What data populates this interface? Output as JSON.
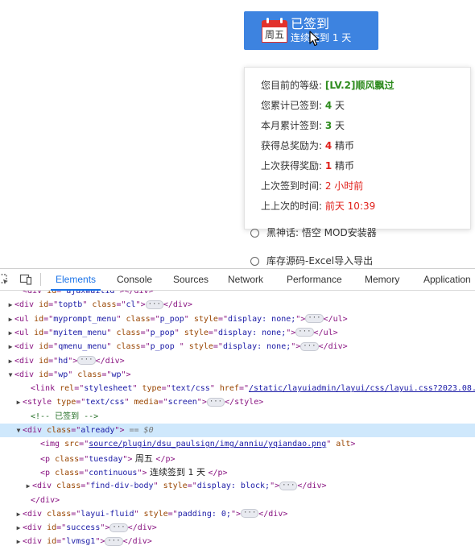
{
  "sign": {
    "weekday": "周五",
    "title": "已签到",
    "subtitle": "连续签到 1 天"
  },
  "popup": {
    "rows": [
      {
        "label": "您目前的等级:",
        "value": "[LV.2]顺风飘过",
        "unit": "",
        "color": "#2e8b1e"
      },
      {
        "label": "您累计已签到:",
        "value": "4",
        "unit": " 天",
        "color": "#2e8b1e"
      },
      {
        "label": "本月累计签到:",
        "value": "3",
        "unit": " 天",
        "color": "#2e8b1e"
      },
      {
        "label": "获得总奖励为:",
        "value": "4",
        "unit": " 精币",
        "color": "#e0201a"
      },
      {
        "label": "上次获得奖励:",
        "value": "1",
        "unit": " 精币",
        "color": "#e0201a"
      },
      {
        "label": "上次签到时间:",
        "value": "2 小时前",
        "unit": "",
        "color": "#e0201a"
      },
      {
        "label": "上上次的时间:",
        "value": "前天 10:39",
        "unit": "",
        "color": "#e0201a"
      }
    ]
  },
  "options": [
    {
      "label": "黑神话: 悟空 MOD安装器"
    },
    {
      "label": "库存源码-Excel导入导出"
    }
  ],
  "devtools": {
    "tabs": [
      "Elements",
      "Console",
      "Sources",
      "Network",
      "Performance",
      "Memory",
      "Application"
    ],
    "active_tab": "Elements",
    "lines": [
      {
        "indent": 28,
        "arrow": "",
        "parts": [
          {
            "c": "t",
            "v": "<div "
          },
          {
            "c": "an",
            "v": "id"
          },
          {
            "c": "t",
            "v": "=\""
          },
          {
            "c": "av",
            "v": "ajaxwaitid"
          },
          {
            "c": "t",
            "v": "\"></div>"
          }
        ]
      },
      {
        "indent": 18,
        "arrow": "▶",
        "parts": [
          {
            "c": "t",
            "v": "<div "
          },
          {
            "c": "an",
            "v": "id"
          },
          {
            "c": "t",
            "v": "=\""
          },
          {
            "c": "av",
            "v": "toptb"
          },
          {
            "c": "t",
            "v": "\" "
          },
          {
            "c": "an",
            "v": "class"
          },
          {
            "c": "t",
            "v": "=\""
          },
          {
            "c": "av",
            "v": "cl"
          },
          {
            "c": "t",
            "v": "\">"
          },
          {
            "c": "ell",
            "v": "···"
          },
          {
            "c": "t",
            "v": "</div>"
          }
        ]
      },
      {
        "indent": 18,
        "arrow": "▶",
        "parts": [
          {
            "c": "t",
            "v": "<ul "
          },
          {
            "c": "an",
            "v": "id"
          },
          {
            "c": "t",
            "v": "=\""
          },
          {
            "c": "av",
            "v": "myprompt_menu"
          },
          {
            "c": "t",
            "v": "\" "
          },
          {
            "c": "an",
            "v": "class"
          },
          {
            "c": "t",
            "v": "=\""
          },
          {
            "c": "av",
            "v": "p_pop"
          },
          {
            "c": "t",
            "v": "\" "
          },
          {
            "c": "an",
            "v": "style"
          },
          {
            "c": "t",
            "v": "=\""
          },
          {
            "c": "av",
            "v": "display: none;"
          },
          {
            "c": "t",
            "v": "\">"
          },
          {
            "c": "ell",
            "v": "···"
          },
          {
            "c": "t",
            "v": "</ul>"
          }
        ]
      },
      {
        "indent": 18,
        "arrow": "▶",
        "parts": [
          {
            "c": "t",
            "v": "<ul "
          },
          {
            "c": "an",
            "v": "id"
          },
          {
            "c": "t",
            "v": "=\""
          },
          {
            "c": "av",
            "v": "myitem_menu"
          },
          {
            "c": "t",
            "v": "\" "
          },
          {
            "c": "an",
            "v": "class"
          },
          {
            "c": "t",
            "v": "=\""
          },
          {
            "c": "av",
            "v": "p_pop"
          },
          {
            "c": "t",
            "v": "\" "
          },
          {
            "c": "an",
            "v": "style"
          },
          {
            "c": "t",
            "v": "=\""
          },
          {
            "c": "av",
            "v": "display: none;"
          },
          {
            "c": "t",
            "v": "\">"
          },
          {
            "c": "ell",
            "v": "···"
          },
          {
            "c": "t",
            "v": "</ul>"
          }
        ]
      },
      {
        "indent": 18,
        "arrow": "▶",
        "parts": [
          {
            "c": "t",
            "v": "<div "
          },
          {
            "c": "an",
            "v": "id"
          },
          {
            "c": "t",
            "v": "=\""
          },
          {
            "c": "av",
            "v": "qmenu_menu"
          },
          {
            "c": "t",
            "v": "\" "
          },
          {
            "c": "an",
            "v": "class"
          },
          {
            "c": "t",
            "v": "=\""
          },
          {
            "c": "av",
            "v": "p_pop "
          },
          {
            "c": "t",
            "v": "\" "
          },
          {
            "c": "an",
            "v": "style"
          },
          {
            "c": "t",
            "v": "=\""
          },
          {
            "c": "av",
            "v": "display: none;"
          },
          {
            "c": "t",
            "v": "\">"
          },
          {
            "c": "ell",
            "v": "···"
          },
          {
            "c": "t",
            "v": "</div>"
          }
        ]
      },
      {
        "indent": 18,
        "arrow": "▶",
        "parts": [
          {
            "c": "t",
            "v": "<div "
          },
          {
            "c": "an",
            "v": "id"
          },
          {
            "c": "t",
            "v": "=\""
          },
          {
            "c": "av",
            "v": "hd"
          },
          {
            "c": "t",
            "v": "\">"
          },
          {
            "c": "ell",
            "v": "···"
          },
          {
            "c": "t",
            "v": "</div>"
          }
        ]
      },
      {
        "indent": 18,
        "arrow": "▼",
        "parts": [
          {
            "c": "t",
            "v": "<div "
          },
          {
            "c": "an",
            "v": "id"
          },
          {
            "c": "t",
            "v": "=\""
          },
          {
            "c": "av",
            "v": "wp"
          },
          {
            "c": "t",
            "v": "\" "
          },
          {
            "c": "an",
            "v": "class"
          },
          {
            "c": "t",
            "v": "=\""
          },
          {
            "c": "av",
            "v": "wp"
          },
          {
            "c": "t",
            "v": "\">"
          }
        ]
      },
      {
        "indent": 38,
        "arrow": "",
        "parts": [
          {
            "c": "t",
            "v": "<link "
          },
          {
            "c": "an",
            "v": "rel"
          },
          {
            "c": "t",
            "v": "=\""
          },
          {
            "c": "av",
            "v": "stylesheet"
          },
          {
            "c": "t",
            "v": "\" "
          },
          {
            "c": "an",
            "v": "type"
          },
          {
            "c": "t",
            "v": "=\""
          },
          {
            "c": "av",
            "v": "text/css"
          },
          {
            "c": "t",
            "v": "\" "
          },
          {
            "c": "an",
            "v": "href"
          },
          {
            "c": "t",
            "v": "=\""
          },
          {
            "c": "avl",
            "v": "/static/layuiadmin/layui/css/layui.css?2023.08."
          }
        ]
      },
      {
        "indent": 28,
        "arrow": "▶",
        "parts": [
          {
            "c": "t",
            "v": "<style "
          },
          {
            "c": "an",
            "v": "type"
          },
          {
            "c": "t",
            "v": "=\""
          },
          {
            "c": "av",
            "v": "text/css"
          },
          {
            "c": "t",
            "v": "\" "
          },
          {
            "c": "an",
            "v": "media"
          },
          {
            "c": "t",
            "v": "=\""
          },
          {
            "c": "av",
            "v": "screen"
          },
          {
            "c": "t",
            "v": "\">"
          },
          {
            "c": "ell",
            "v": "···"
          },
          {
            "c": "t",
            "v": "</style>"
          }
        ]
      },
      {
        "indent": 38,
        "arrow": "",
        "parts": [
          {
            "c": "cm",
            "v": "<!-- 已签到 -->"
          }
        ]
      },
      {
        "indent": 28,
        "arrow": "▼",
        "sel": true,
        "parts": [
          {
            "c": "t",
            "v": "<div "
          },
          {
            "c": "an",
            "v": "class"
          },
          {
            "c": "t",
            "v": "=\""
          },
          {
            "c": "av",
            "v": "already"
          },
          {
            "c": "t",
            "v": "\">"
          },
          {
            "c": "eq",
            "v": " == $0"
          }
        ]
      },
      {
        "indent": 50,
        "arrow": "",
        "parts": [
          {
            "c": "t",
            "v": "<img "
          },
          {
            "c": "an",
            "v": "src"
          },
          {
            "c": "t",
            "v": "=\""
          },
          {
            "c": "avl",
            "v": "source/plugin/dsu_paulsign/img/anniu/yqiandao.png"
          },
          {
            "c": "t",
            "v": "\" "
          },
          {
            "c": "an",
            "v": "alt"
          },
          {
            "c": "t",
            "v": ">"
          }
        ]
      },
      {
        "indent": 50,
        "arrow": "",
        "parts": [
          {
            "c": "t",
            "v": "<p "
          },
          {
            "c": "an",
            "v": "class"
          },
          {
            "c": "t",
            "v": "=\""
          },
          {
            "c": "av",
            "v": "tuesday"
          },
          {
            "c": "t",
            "v": "\">"
          },
          {
            "c": "txt",
            "v": " 周五 "
          },
          {
            "c": "t",
            "v": "</p>"
          }
        ]
      },
      {
        "indent": 50,
        "arrow": "",
        "parts": [
          {
            "c": "t",
            "v": "<p "
          },
          {
            "c": "an",
            "v": "class"
          },
          {
            "c": "t",
            "v": "=\""
          },
          {
            "c": "av",
            "v": "continuous"
          },
          {
            "c": "t",
            "v": "\">"
          },
          {
            "c": "txt",
            "v": " 连续签到 1 天 "
          },
          {
            "c": "t",
            "v": "</p>"
          }
        ]
      },
      {
        "indent": 40,
        "arrow": "▶",
        "parts": [
          {
            "c": "t",
            "v": "<div "
          },
          {
            "c": "an",
            "v": "class"
          },
          {
            "c": "t",
            "v": "=\""
          },
          {
            "c": "av",
            "v": "find-div-body"
          },
          {
            "c": "t",
            "v": "\" "
          },
          {
            "c": "an",
            "v": "style"
          },
          {
            "c": "t",
            "v": "=\""
          },
          {
            "c": "av",
            "v": "display: block;"
          },
          {
            "c": "t",
            "v": "\">"
          },
          {
            "c": "ell",
            "v": "···"
          },
          {
            "c": "t",
            "v": "</div>"
          }
        ]
      },
      {
        "indent": 38,
        "arrow": "",
        "parts": [
          {
            "c": "t",
            "v": "</div>"
          }
        ]
      },
      {
        "indent": 28,
        "arrow": "▶",
        "parts": [
          {
            "c": "t",
            "v": "<div "
          },
          {
            "c": "an",
            "v": "class"
          },
          {
            "c": "t",
            "v": "=\""
          },
          {
            "c": "av",
            "v": "layui-fluid"
          },
          {
            "c": "t",
            "v": "\" "
          },
          {
            "c": "an",
            "v": "style"
          },
          {
            "c": "t",
            "v": "=\""
          },
          {
            "c": "av",
            "v": "padding: 0;"
          },
          {
            "c": "t",
            "v": "\">"
          },
          {
            "c": "ell",
            "v": "···"
          },
          {
            "c": "t",
            "v": "</div>"
          }
        ]
      },
      {
        "indent": 28,
        "arrow": "▶",
        "parts": [
          {
            "c": "t",
            "v": "<div "
          },
          {
            "c": "an",
            "v": "id"
          },
          {
            "c": "t",
            "v": "=\""
          },
          {
            "c": "av",
            "v": "success"
          },
          {
            "c": "t",
            "v": "\">"
          },
          {
            "c": "ell",
            "v": "···"
          },
          {
            "c": "t",
            "v": "</div>"
          }
        ]
      },
      {
        "indent": 28,
        "arrow": "▶",
        "parts": [
          {
            "c": "t",
            "v": "<div "
          },
          {
            "c": "an",
            "v": "id"
          },
          {
            "c": "t",
            "v": "=\""
          },
          {
            "c": "av",
            "v": "lvmsg1"
          },
          {
            "c": "t",
            "v": "\">"
          },
          {
            "c": "ell",
            "v": "···"
          },
          {
            "c": "t",
            "v": "</div>"
          }
        ]
      }
    ]
  }
}
